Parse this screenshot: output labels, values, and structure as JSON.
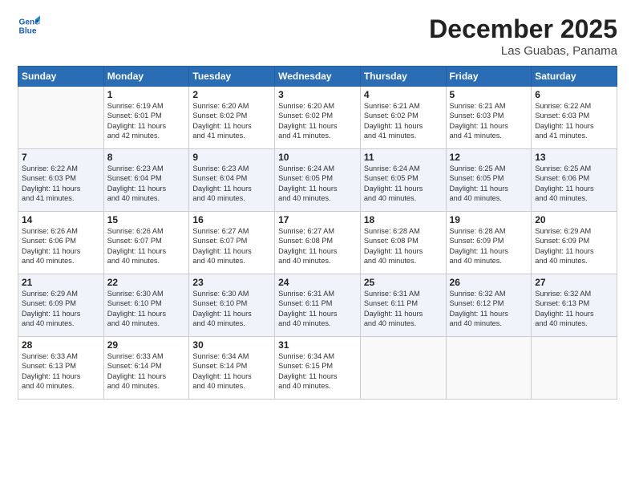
{
  "header": {
    "logo": {
      "line1": "General",
      "line2": "Blue"
    },
    "title": "December 2025",
    "location": "Las Guabas, Panama"
  },
  "weekdays": [
    "Sunday",
    "Monday",
    "Tuesday",
    "Wednesday",
    "Thursday",
    "Friday",
    "Saturday"
  ],
  "weeks": [
    [
      {
        "day": "",
        "info": ""
      },
      {
        "day": "1",
        "info": "Sunrise: 6:19 AM\nSunset: 6:01 PM\nDaylight: 11 hours\nand 42 minutes."
      },
      {
        "day": "2",
        "info": "Sunrise: 6:20 AM\nSunset: 6:02 PM\nDaylight: 11 hours\nand 41 minutes."
      },
      {
        "day": "3",
        "info": "Sunrise: 6:20 AM\nSunset: 6:02 PM\nDaylight: 11 hours\nand 41 minutes."
      },
      {
        "day": "4",
        "info": "Sunrise: 6:21 AM\nSunset: 6:02 PM\nDaylight: 11 hours\nand 41 minutes."
      },
      {
        "day": "5",
        "info": "Sunrise: 6:21 AM\nSunset: 6:03 PM\nDaylight: 11 hours\nand 41 minutes."
      },
      {
        "day": "6",
        "info": "Sunrise: 6:22 AM\nSunset: 6:03 PM\nDaylight: 11 hours\nand 41 minutes."
      }
    ],
    [
      {
        "day": "7",
        "info": "Sunrise: 6:22 AM\nSunset: 6:03 PM\nDaylight: 11 hours\nand 41 minutes."
      },
      {
        "day": "8",
        "info": "Sunrise: 6:23 AM\nSunset: 6:04 PM\nDaylight: 11 hours\nand 40 minutes."
      },
      {
        "day": "9",
        "info": "Sunrise: 6:23 AM\nSunset: 6:04 PM\nDaylight: 11 hours\nand 40 minutes."
      },
      {
        "day": "10",
        "info": "Sunrise: 6:24 AM\nSunset: 6:05 PM\nDaylight: 11 hours\nand 40 minutes."
      },
      {
        "day": "11",
        "info": "Sunrise: 6:24 AM\nSunset: 6:05 PM\nDaylight: 11 hours\nand 40 minutes."
      },
      {
        "day": "12",
        "info": "Sunrise: 6:25 AM\nSunset: 6:05 PM\nDaylight: 11 hours\nand 40 minutes."
      },
      {
        "day": "13",
        "info": "Sunrise: 6:25 AM\nSunset: 6:06 PM\nDaylight: 11 hours\nand 40 minutes."
      }
    ],
    [
      {
        "day": "14",
        "info": "Sunrise: 6:26 AM\nSunset: 6:06 PM\nDaylight: 11 hours\nand 40 minutes."
      },
      {
        "day": "15",
        "info": "Sunrise: 6:26 AM\nSunset: 6:07 PM\nDaylight: 11 hours\nand 40 minutes."
      },
      {
        "day": "16",
        "info": "Sunrise: 6:27 AM\nSunset: 6:07 PM\nDaylight: 11 hours\nand 40 minutes."
      },
      {
        "day": "17",
        "info": "Sunrise: 6:27 AM\nSunset: 6:08 PM\nDaylight: 11 hours\nand 40 minutes."
      },
      {
        "day": "18",
        "info": "Sunrise: 6:28 AM\nSunset: 6:08 PM\nDaylight: 11 hours\nand 40 minutes."
      },
      {
        "day": "19",
        "info": "Sunrise: 6:28 AM\nSunset: 6:09 PM\nDaylight: 11 hours\nand 40 minutes."
      },
      {
        "day": "20",
        "info": "Sunrise: 6:29 AM\nSunset: 6:09 PM\nDaylight: 11 hours\nand 40 minutes."
      }
    ],
    [
      {
        "day": "21",
        "info": "Sunrise: 6:29 AM\nSunset: 6:09 PM\nDaylight: 11 hours\nand 40 minutes."
      },
      {
        "day": "22",
        "info": "Sunrise: 6:30 AM\nSunset: 6:10 PM\nDaylight: 11 hours\nand 40 minutes."
      },
      {
        "day": "23",
        "info": "Sunrise: 6:30 AM\nSunset: 6:10 PM\nDaylight: 11 hours\nand 40 minutes."
      },
      {
        "day": "24",
        "info": "Sunrise: 6:31 AM\nSunset: 6:11 PM\nDaylight: 11 hours\nand 40 minutes."
      },
      {
        "day": "25",
        "info": "Sunrise: 6:31 AM\nSunset: 6:11 PM\nDaylight: 11 hours\nand 40 minutes."
      },
      {
        "day": "26",
        "info": "Sunrise: 6:32 AM\nSunset: 6:12 PM\nDaylight: 11 hours\nand 40 minutes."
      },
      {
        "day": "27",
        "info": "Sunrise: 6:32 AM\nSunset: 6:13 PM\nDaylight: 11 hours\nand 40 minutes."
      }
    ],
    [
      {
        "day": "28",
        "info": "Sunrise: 6:33 AM\nSunset: 6:13 PM\nDaylight: 11 hours\nand 40 minutes."
      },
      {
        "day": "29",
        "info": "Sunrise: 6:33 AM\nSunset: 6:14 PM\nDaylight: 11 hours\nand 40 minutes."
      },
      {
        "day": "30",
        "info": "Sunrise: 6:34 AM\nSunset: 6:14 PM\nDaylight: 11 hours\nand 40 minutes."
      },
      {
        "day": "31",
        "info": "Sunrise: 6:34 AM\nSunset: 6:15 PM\nDaylight: 11 hours\nand 40 minutes."
      },
      {
        "day": "",
        "info": ""
      },
      {
        "day": "",
        "info": ""
      },
      {
        "day": "",
        "info": ""
      }
    ]
  ]
}
